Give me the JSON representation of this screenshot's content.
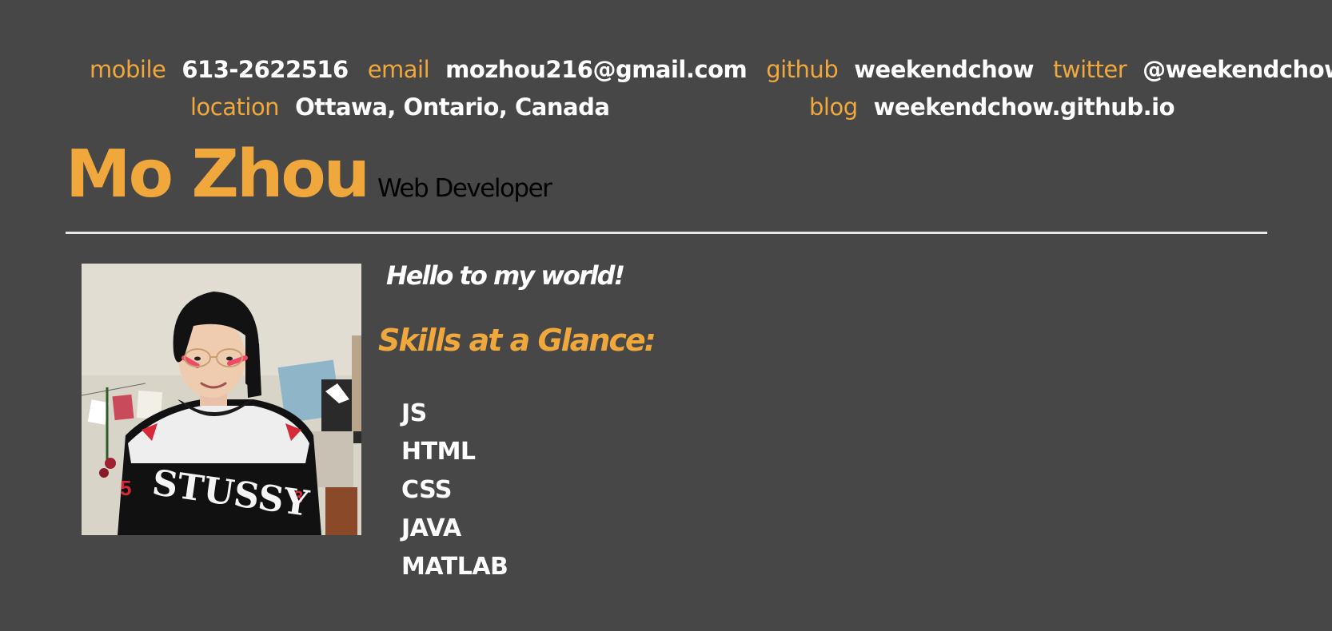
{
  "contact": {
    "mobile": {
      "label": "mobile",
      "value": "613-2622516"
    },
    "email": {
      "label": "email",
      "value": "mozhou216@gmail.com"
    },
    "github": {
      "label": "github",
      "value": "weekendchow"
    },
    "twitter": {
      "label": "twitter",
      "value": "@weekendchow"
    },
    "location": {
      "label": "location",
      "value": "Ottawa, Ontario, Canada"
    },
    "blog": {
      "label": "blog",
      "value": "weekendchow.github.io"
    }
  },
  "header": {
    "name": "Mo Zhou",
    "role": "Web Developer"
  },
  "main": {
    "greeting": "Hello to my world!",
    "skills_title": "Skills at a Glance:",
    "skills": [
      "JS",
      "HTML",
      "CSS",
      "JAVA",
      "MATLAB"
    ]
  },
  "colors": {
    "background": "#474747",
    "accent": "#f0a83c",
    "text": "#ffffff",
    "role_text": "#000000"
  }
}
